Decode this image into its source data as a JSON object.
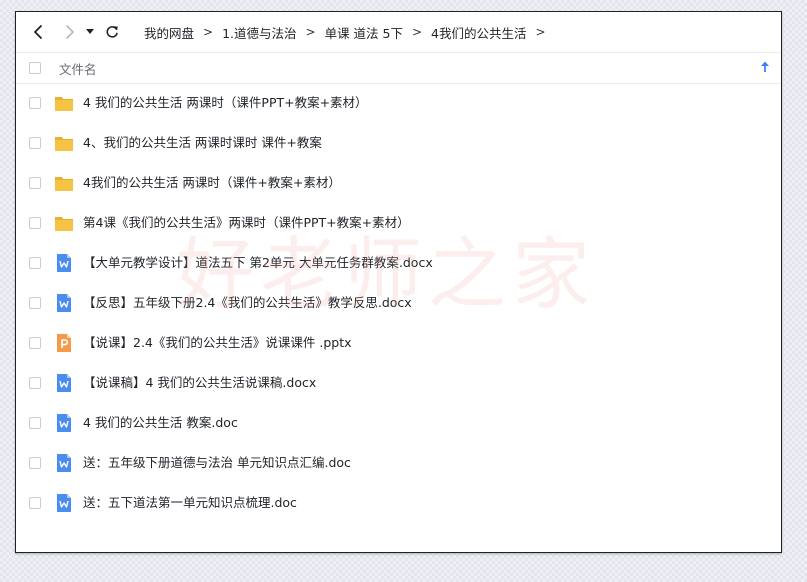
{
  "navbar": {
    "back_icon": "chevron-left-icon",
    "forward_icon": "chevron-right-icon",
    "dropdown_icon": "caret-down-icon",
    "refresh_icon": "refresh-icon"
  },
  "breadcrumb": [
    "我的网盘",
    "1.道德与法治",
    "单课 道法 5下",
    "4我们的公共生活"
  ],
  "breadcrumb_separator": ">",
  "list_header": {
    "name_label": "文件名",
    "sort_icon": "sort-ascending-icon"
  },
  "watermark": "好老师之家",
  "files": [
    {
      "name": "4 我们的公共生活 两课时（课件PPT+教案+素材）",
      "type": "folder"
    },
    {
      "name": "4、我们的公共生活 两课时课时  课件+教案",
      "type": "folder"
    },
    {
      "name": "4我们的公共生活  两课时（课件+教案+素材）",
      "type": "folder"
    },
    {
      "name": "第4课《我们的公共生活》两课时（课件PPT+教案+素材）",
      "type": "folder"
    },
    {
      "name": "【大单元教学设计】道法五下 第2单元 大单元任务群教案.docx",
      "type": "word"
    },
    {
      "name": "【反思】五年级下册2.4《我们的公共生活》教学反思.docx",
      "type": "word"
    },
    {
      "name": "【说课】2.4《我们的公共生活》说课课件 .pptx",
      "type": "ppt"
    },
    {
      "name": "【说课稿】4 我们的公共生活说课稿.docx",
      "type": "word"
    },
    {
      "name": "4 我们的公共生活  教案.doc",
      "type": "word"
    },
    {
      "name": "送：五年级下册道德与法治 单元知识点汇编.doc",
      "type": "word"
    },
    {
      "name": "送：五下道法第一单元知识点梳理.doc",
      "type": "word"
    }
  ],
  "colors": {
    "folder": "#f6c342",
    "folder_tab": "#eab12f",
    "word": "#4a8cf0",
    "ppt": "#f59a4a",
    "sort_arrow": "#3b82f6"
  }
}
